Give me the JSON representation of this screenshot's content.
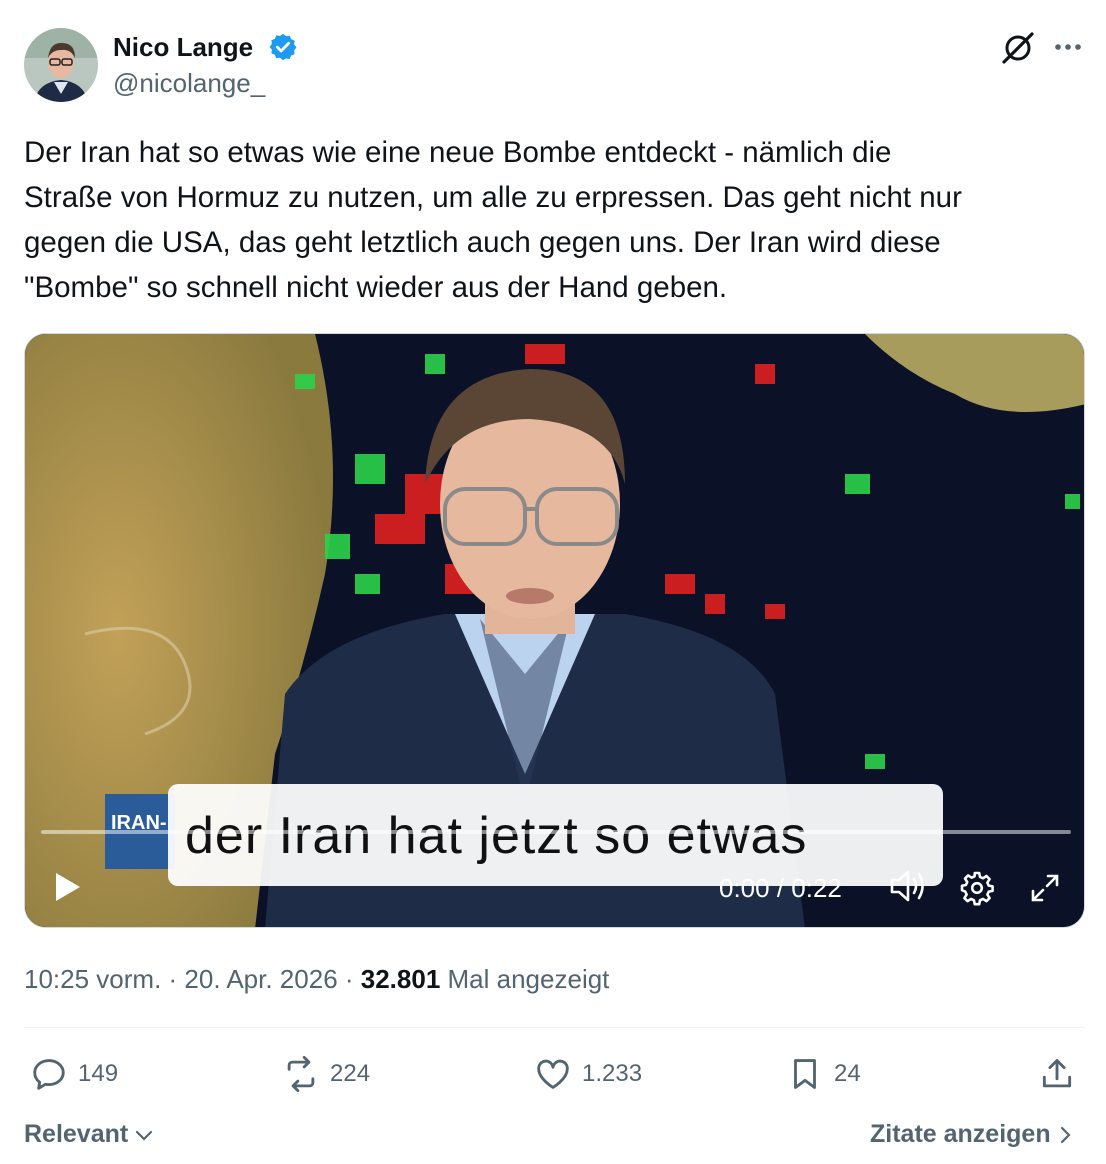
{
  "author": {
    "name": "Nico Lange",
    "handle": "@nicolange_",
    "verified": true
  },
  "tweet": {
    "text": "Der Iran hat so etwas wie eine neue Bombe entdeckt - nämlich die\nStraße von Hormuz zu nutzen, um alle zu erpressen. Das geht nicht nur\ngegen die USA, das geht letztlich auch gegen uns. Der Iran wird diese\n\"Bombe\" so schnell nicht wieder aus der Hand geben."
  },
  "video": {
    "caption": "der Iran hat jetzt so etwas",
    "lower_third": "IRAN-",
    "time": "0:00 / 0:22",
    "progress": 0
  },
  "meta": {
    "time": "10:25 vorm.",
    "sep1": " · ",
    "date": "20. Apr. 2026",
    "sep2": " · ",
    "views": "32.801",
    "views_label": " Mal angezeigt"
  },
  "actions": {
    "replies": "149",
    "reposts": "224",
    "likes": "1.233",
    "bookmarks": "24"
  },
  "footer": {
    "relevant": "Relevant",
    "quotes": "Zitate anzeigen"
  },
  "icons": [
    "verified-badge-icon",
    "grok-icon",
    "more-icon",
    "play-icon",
    "volume-icon",
    "settings-icon",
    "fullscreen-icon",
    "reply-icon",
    "repost-icon",
    "like-icon",
    "bookmark-icon",
    "share-icon",
    "chevron-down-icon",
    "chevron-right-icon"
  ],
  "colors": {
    "verified": "#1d9bf0",
    "text": "#0f1419",
    "secondary": "#536471"
  }
}
